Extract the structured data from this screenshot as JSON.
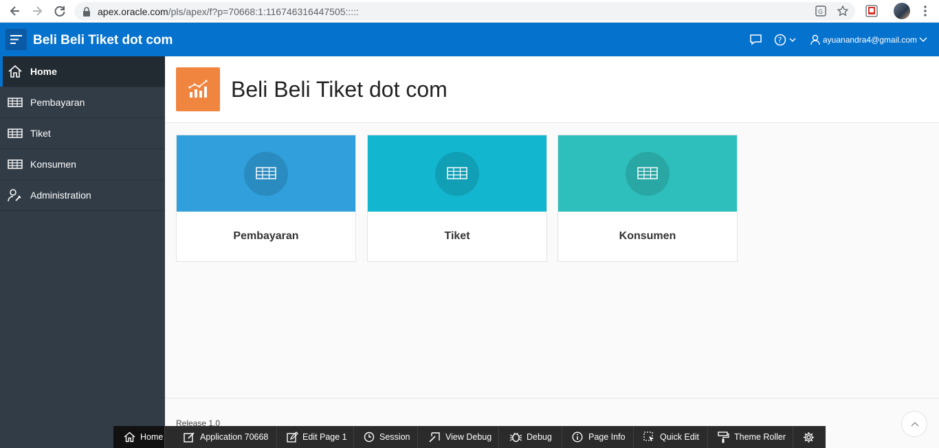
{
  "browser": {
    "url_host": "apex.oracle.com",
    "url_path": "/pls/apex/f?p=70668:1:116746316447505:::::"
  },
  "header": {
    "app_title": "Beli Beli Tiket dot com",
    "user": "ayuanandra4@gmail.com"
  },
  "sidebar": {
    "items": [
      {
        "label": "Home",
        "icon": "home-icon",
        "active": true
      },
      {
        "label": "Pembayaran",
        "icon": "table-icon"
      },
      {
        "label": "Tiket",
        "icon": "table-icon"
      },
      {
        "label": "Konsumen",
        "icon": "table-icon"
      },
      {
        "label": "Administration",
        "icon": "user-wrench-icon"
      }
    ]
  },
  "hero": {
    "title": "Beli Beli Tiket dot com",
    "icon": "chart-icon",
    "icon_color": "#f0853f"
  },
  "cards": [
    {
      "label": "Pembayaran",
      "color": "#309fdb"
    },
    {
      "label": "Tiket",
      "color": "#13b6cf"
    },
    {
      "label": "Konsumen",
      "color": "#2ebfbc"
    }
  ],
  "footer": {
    "release": "Release 1.0"
  },
  "devbar": {
    "items": [
      {
        "label": "Home",
        "icon": "home-icon"
      },
      {
        "label": "Application 70668",
        "icon": "edit-app-icon"
      },
      {
        "label": "Edit Page 1",
        "icon": "edit-page-icon"
      },
      {
        "label": "Session",
        "icon": "clock-icon"
      },
      {
        "label": "View Debug",
        "icon": "view-debug-icon"
      },
      {
        "label": "Debug",
        "icon": "bug-icon"
      },
      {
        "label": "Page Info",
        "icon": "info-icon"
      },
      {
        "label": "Quick Edit",
        "icon": "quick-edit-icon"
      },
      {
        "label": "Theme Roller",
        "icon": "paint-roller-icon"
      },
      {
        "label": "",
        "icon": "gear-icon"
      }
    ]
  },
  "colors": {
    "header": "#0572ce",
    "sidebar": "#323c47",
    "devbar": "#2b2b2b"
  }
}
